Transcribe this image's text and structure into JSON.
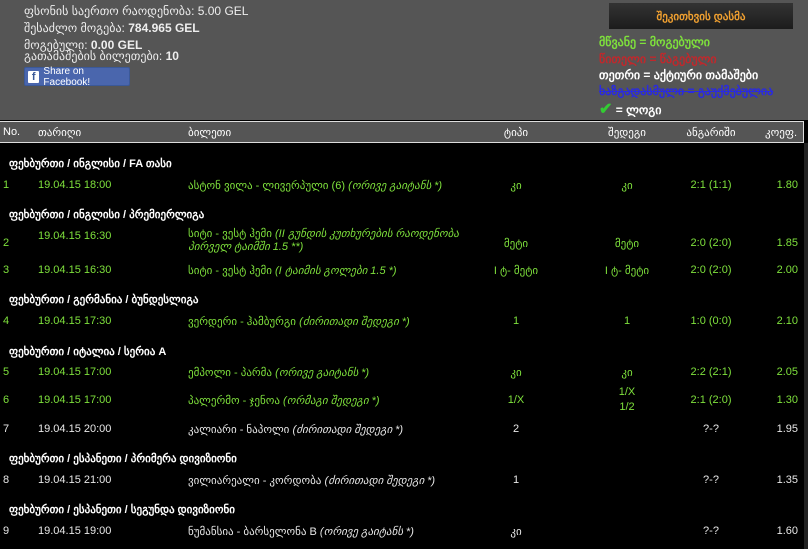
{
  "summary": {
    "total_bet_label": "ფსონის საერთო რაოდენობა:",
    "total_bet": "5.00 GEL",
    "possible_win_label": "შესაძლო მოგება:",
    "possible_win": "784.965 GEL",
    "won_label": "მოგებული:",
    "won": "0.00 GEL",
    "tickets_label": "გათამაშების ბილეთები:",
    "tickets": "10",
    "share_label": "Share on Facebook!"
  },
  "ask_button": "შეკითხვის დასმა",
  "legend": {
    "green": "მწვანე = მოგებული",
    "red": "წითელი = წაგებული",
    "white": "თეთრი = აქტიური თამაშები",
    "struck": "ხაზგადასმული = გაუქმებულია",
    "check": "= ლოგი"
  },
  "colors": {
    "green": "#7ee03c",
    "red": "#c0282c",
    "blue": "#2a2ae0",
    "orange": "#f0a030"
  },
  "headers": {
    "no": "No.",
    "date": "თარიღი",
    "ticket": "ბილეთი",
    "type": "ტიპი",
    "result": "შედეგი",
    "score": "ანგარიში",
    "coef": "კოეფ."
  },
  "categories": [
    "ფეხბურთი / ინგლისი / FA თასი",
    "ფეხბურთი / ინგლისი / პრემიერლიგა",
    "ფეხბურთი / გერმანია / ბუნდესლიგა",
    "ფეხბურთი / იტალია / სერია A",
    "ფეხბურთი / ესპანეთი / პრიმერა დივიზიონი",
    "ფეხბურთი / ესპანეთი / სეგუნდა დივიზიონი"
  ],
  "rows": [
    {
      "no": "1",
      "date": "19.04.15 18:00",
      "match": "ასტონ ვილა - ლივერპული (6)",
      "bet": "(ორივე გაიტანს *)",
      "type": "კი",
      "result": "კი",
      "score": "2:1 (1:1)",
      "coef": "1.80"
    },
    {
      "no": "2",
      "date": "19.04.15 16:30",
      "match": "სიტი - ვესტ ჰემი",
      "bet": "(II გუნდის კუთხურების რაოდენობა",
      "bet2": "პირველ ტაიმში 1.5 **)",
      "type": "მეტი",
      "result": "მეტი",
      "score": "2:0 (2:0)",
      "coef": "1.85"
    },
    {
      "no": "3",
      "date": "19.04.15 16:30",
      "match": "სიტი - ვესტ ჰემი",
      "bet": "(I ტაიმის გოლები 1.5 *)",
      "type": "I ტ- მეტი",
      "result": "I ტ- მეტი",
      "score": "2:0 (2:0)",
      "coef": "2.00"
    },
    {
      "no": "4",
      "date": "19.04.15 17:30",
      "match": "ვერდერი - ჰამბურგი",
      "bet": "(ძირითადი შედეგი *)",
      "type": "1",
      "result": "1",
      "score": "1:0 (0:0)",
      "coef": "2.10"
    },
    {
      "no": "5",
      "date": "19.04.15 17:00",
      "match": "ემპოლი - პარმა",
      "bet": "(ორივე გაიტანს *)",
      "type": "კი",
      "result": "კი",
      "score": "2:2 (2:1)",
      "coef": "2.05"
    },
    {
      "no": "6",
      "date": "19.04.15 17:00",
      "match": "პალერმო - ჯენოა",
      "bet": "(ორმაგი შედეგი *)",
      "type": "1/X",
      "result": "1/X",
      "result2": "1/2",
      "score": "2:1 (2:0)",
      "coef": "1.30"
    },
    {
      "no": "7",
      "date": "19.04.15 20:00",
      "match": "კალიარი - ნაპოლი",
      "bet": "(ძირითადი შედეგი *)",
      "type": "2",
      "result": "",
      "score": "?-?",
      "coef": "1.95"
    },
    {
      "no": "8",
      "date": "19.04.15 21:00",
      "match": "ვილიარეალი - კორდობა",
      "bet": "(ძირითადი შედეგი *)",
      "type": "1",
      "result": "",
      "score": "?-?",
      "coef": "1.35"
    },
    {
      "no": "9",
      "date": "19.04.15 19:00",
      "match": "ნუმანსია - ბარსელონა B",
      "bet": "(ორივე გაიტანს *)",
      "type": "კი",
      "result": "",
      "score": "?-?",
      "coef": "1.60"
    }
  ]
}
